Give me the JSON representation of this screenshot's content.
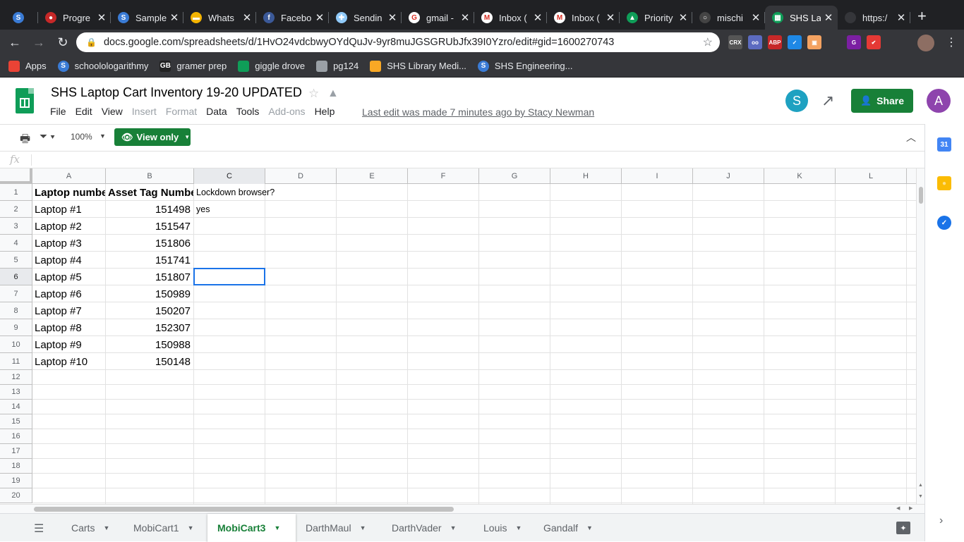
{
  "browser": {
    "tabs": [
      {
        "title": "",
        "icon": "schoology-icon",
        "color": "#3a7bd5",
        "glyph": "S"
      },
      {
        "title": "Progre",
        "icon": "progress-icon",
        "color": "#c62828",
        "glyph": "●"
      },
      {
        "title": "Sample",
        "icon": "schoology-icon",
        "color": "#3a7bd5",
        "glyph": "S"
      },
      {
        "title": "Whats",
        "icon": "slides-icon",
        "color": "#f4b400",
        "glyph": "▬"
      },
      {
        "title": "Facebo",
        "icon": "facebook-icon",
        "color": "#3b5998",
        "glyph": "f"
      },
      {
        "title": "Sendin",
        "icon": "sending-icon",
        "color": "#90caf9",
        "glyph": "✚"
      },
      {
        "title": "gmail -",
        "icon": "google-icon",
        "color": "#ffffff",
        "glyph": "G"
      },
      {
        "title": "Inbox (",
        "icon": "gmail-icon",
        "color": "#ffffff",
        "glyph": "M"
      },
      {
        "title": "Inbox (",
        "icon": "gmail-icon",
        "color": "#ffffff",
        "glyph": "M"
      },
      {
        "title": "Priority",
        "icon": "drive-icon",
        "color": "#0f9d58",
        "glyph": "▲"
      },
      {
        "title": "mischi",
        "icon": "github-icon",
        "color": "#444444",
        "glyph": "○"
      },
      {
        "title": "SHS La",
        "icon": "sheets-icon",
        "color": "#0f9d58",
        "glyph": "▦",
        "active": true
      },
      {
        "title": "https:/",
        "icon": "blank-icon",
        "color": "#35363a",
        "glyph": ""
      }
    ],
    "url": "docs.google.com/spreadsheets/d/1HvO24vdcbwyOYdQuJv-9yr8muJGSGRUbJfx39I0Yzro/edit#gid=1600270743",
    "bookmarks": [
      {
        "label": "Apps",
        "icon": "apps-grid-icon",
        "color": "#ea4335"
      },
      {
        "label": "schoolologarithmy",
        "icon": "schoology-icon",
        "color": "#3a7bd5"
      },
      {
        "label": "gramer prep",
        "icon": "gb-icon",
        "color": "#222222"
      },
      {
        "label": "giggle drove",
        "icon": "drive-icon",
        "color": "#0f9d58"
      },
      {
        "label": "pg124",
        "icon": "globe-icon",
        "color": "#9aa0a6"
      },
      {
        "label": "SHS Library Medi...",
        "icon": "library-icon",
        "color": "#f9a825"
      },
      {
        "label": "SHS Engineering...",
        "icon": "schoology-icon",
        "color": "#3a7bd5"
      }
    ],
    "extensions": [
      {
        "label": "CRX",
        "color": "#555555"
      },
      {
        "label": "oo",
        "color": "#5c6bc0"
      },
      {
        "label": "ABP",
        "color": "#c62828"
      },
      {
        "label": "✓",
        "color": "#1e88e5"
      },
      {
        "label": "▣",
        "color": "#f4a261"
      },
      {
        "label": "",
        "color": "#35363a"
      },
      {
        "label": "G",
        "color": "#7b1fa2"
      },
      {
        "label": "✔",
        "color": "#e53935"
      }
    ]
  },
  "doc": {
    "title": "SHS Laptop Cart Inventory 19-20 UPDATED",
    "menu": [
      {
        "label": "File",
        "enabled": true
      },
      {
        "label": "Edit",
        "enabled": true
      },
      {
        "label": "View",
        "enabled": true
      },
      {
        "label": "Insert",
        "enabled": false
      },
      {
        "label": "Format",
        "enabled": false
      },
      {
        "label": "Data",
        "enabled": true
      },
      {
        "label": "Tools",
        "enabled": true
      },
      {
        "label": "Add-ons",
        "enabled": false
      },
      {
        "label": "Help",
        "enabled": true
      }
    ],
    "last_edit": "Last edit was made 7 minutes ago by Stacy Newman",
    "user_initial_collab": "S",
    "share_label": "Share",
    "user_initial": "A"
  },
  "toolbar": {
    "zoom": "100%",
    "view_only_label": "View only",
    "fx": "fx"
  },
  "grid": {
    "columns": [
      "A",
      "B",
      "C",
      "D",
      "E",
      "F",
      "G",
      "H",
      "I",
      "J",
      "K",
      "L"
    ],
    "rows": [
      "1",
      "2",
      "3",
      "4",
      "5",
      "6",
      "7",
      "8",
      "9",
      "10",
      "11",
      "12",
      "13",
      "14",
      "15",
      "16",
      "17",
      "18",
      "19",
      "20"
    ],
    "selected_cell": "C6",
    "cells": {
      "A1": "Laptop number",
      "B1": "Asset Tag Number",
      "C1": "Lockdown browser?",
      "A2": "Laptop #1",
      "B2": "151498",
      "C2": "yes",
      "A3": "Laptop #2",
      "B3": "151547",
      "A4": "Laptop #3",
      "B4": "151806",
      "A5": "Laptop #4",
      "B5": "151741",
      "A6": "Laptop #5",
      "B6": "151807",
      "A7": "Laptop #6",
      "B7": "150989",
      "A8": "Laptop #7",
      "B8": "150207",
      "A9": "Laptop #8",
      "B9": "152307",
      "A10": "Laptop #9",
      "B10": "150988",
      "A11": "Laptop #10",
      "B11": "150148"
    }
  },
  "sheet_tabs": [
    {
      "label": "Carts",
      "active": false
    },
    {
      "label": "MobiCart1",
      "active": false
    },
    {
      "label": "MobiCart3",
      "active": true
    },
    {
      "label": "DarthMaul",
      "active": false
    },
    {
      "label": "DarthVader",
      "active": false
    },
    {
      "label": "Louis",
      "active": false
    },
    {
      "label": "Gandalf",
      "active": false
    }
  ],
  "side_panel": [
    {
      "icon": "calendar-icon",
      "color": "#4285f4",
      "glyph": "31"
    },
    {
      "icon": "keep-icon",
      "color": "#fbbc04",
      "glyph": "●"
    },
    {
      "icon": "tasks-icon",
      "color": "#1a73e8",
      "glyph": "✓"
    }
  ]
}
